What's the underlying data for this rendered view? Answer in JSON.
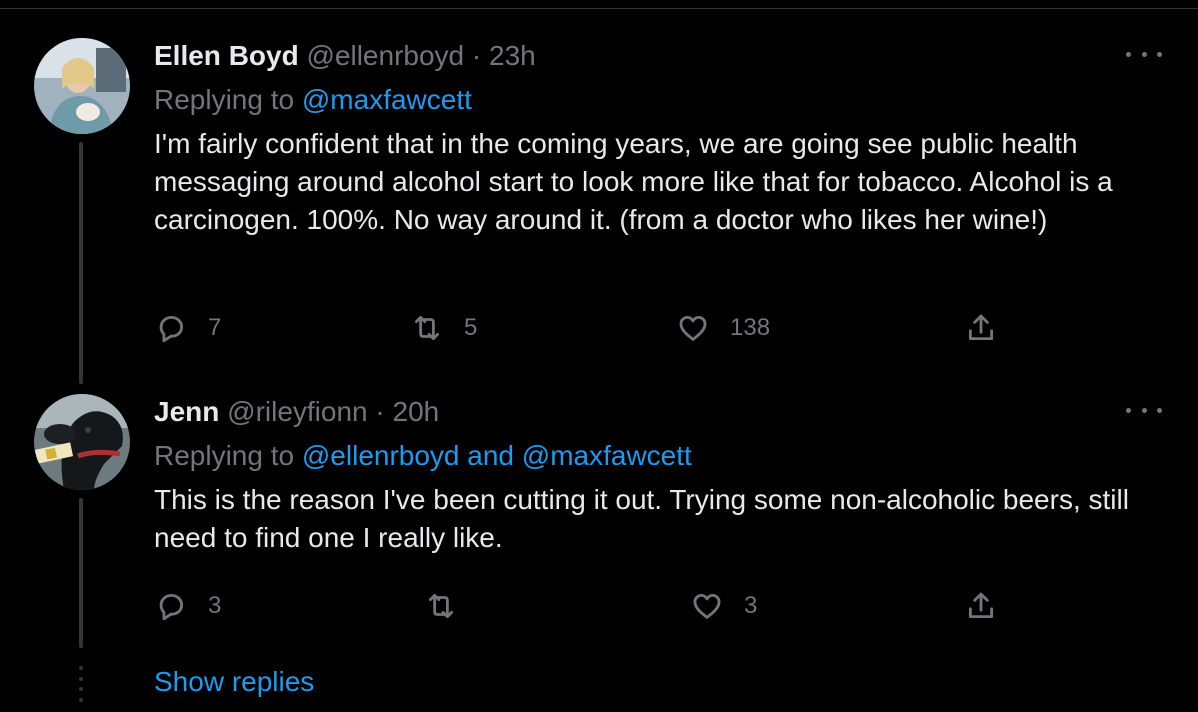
{
  "tweets": [
    {
      "name": "Ellen Boyd",
      "handle": "@ellenrboyd",
      "separator": "·",
      "time": "23h",
      "replying_prefix": "Replying to ",
      "replying_to": "@maxfawcett",
      "text": "I'm fairly confident that in the coming years, we are going see public health messaging around alcohol start to look more like that for tobacco. Alcohol is a carcinogen. 100%. No way around it. (from a doctor who likes her wine!)",
      "replies": "7",
      "retweets": "5",
      "likes": "138",
      "avatar_colors": [
        "#c8d4dc",
        "#7a8a96",
        "#e0c8a8"
      ]
    },
    {
      "name": "Jenn",
      "handle": "@rileyfionn",
      "separator": "·",
      "time": "20h",
      "replying_prefix": "Replying to ",
      "replying_to": "@ellenrboyd and @maxfawcett",
      "text": "This is the reason I've been cutting it out. Trying some non-alcoholic beers, still need to find one I really like.",
      "replies": "3",
      "retweets": "",
      "likes": "3",
      "avatar_colors": [
        "#2a2e33",
        "#c9a23a",
        "#b03030"
      ]
    }
  ],
  "show_replies": "Show replies",
  "icons": {
    "reply": "reply-icon",
    "retweet": "retweet-icon",
    "like": "heart-icon",
    "share": "share-icon",
    "more": "more-icon"
  },
  "colors": {
    "background": "#000000",
    "text": "#e7e9ea",
    "muted": "#71767b",
    "accent": "#1d9bf0",
    "line": "#333639"
  }
}
